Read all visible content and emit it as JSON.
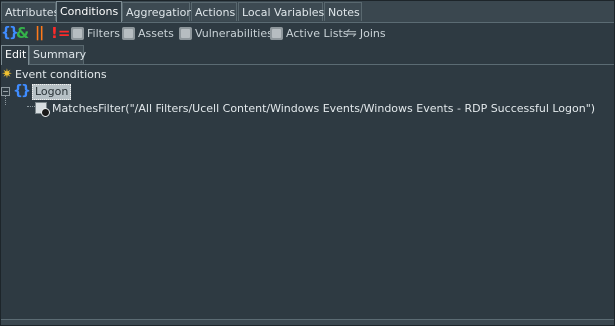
{
  "tabs": [
    {
      "label": "Attributes"
    },
    {
      "label": "Conditions"
    },
    {
      "label": "Aggregation"
    },
    {
      "label": "Actions"
    },
    {
      "label": "Local Variables"
    },
    {
      "label": "Notes"
    }
  ],
  "toolbar": {
    "brace_glyph": "{}",
    "and_glyph": "&",
    "or_glyph": "||",
    "not_glyph": "!=",
    "filters_label": "Filters",
    "assets_label": "Assets",
    "vulnerabilities_label": "Vulnerabilities",
    "active_lists_label": "Active Lists",
    "joins_label": "Joins"
  },
  "subtabs": [
    {
      "label": "Edit"
    },
    {
      "label": "Summary"
    }
  ],
  "tree": {
    "root_label": "Event conditions",
    "group_label": "Logon",
    "condition_text": "MatchesFilter(\"/All Filters/Ucell Content/Windows Events/Windows Events - RDP Successful Logon\")"
  },
  "colors": {
    "background": "#2e3a42",
    "brace": "#3f8cff",
    "and": "#35b34a",
    "or": "#ff7a1a",
    "not": "#ff2a2a",
    "star": "#f2c230"
  },
  "icons": {
    "root": "star-icon",
    "group": "brace-icon",
    "condition": "filter-icon"
  }
}
